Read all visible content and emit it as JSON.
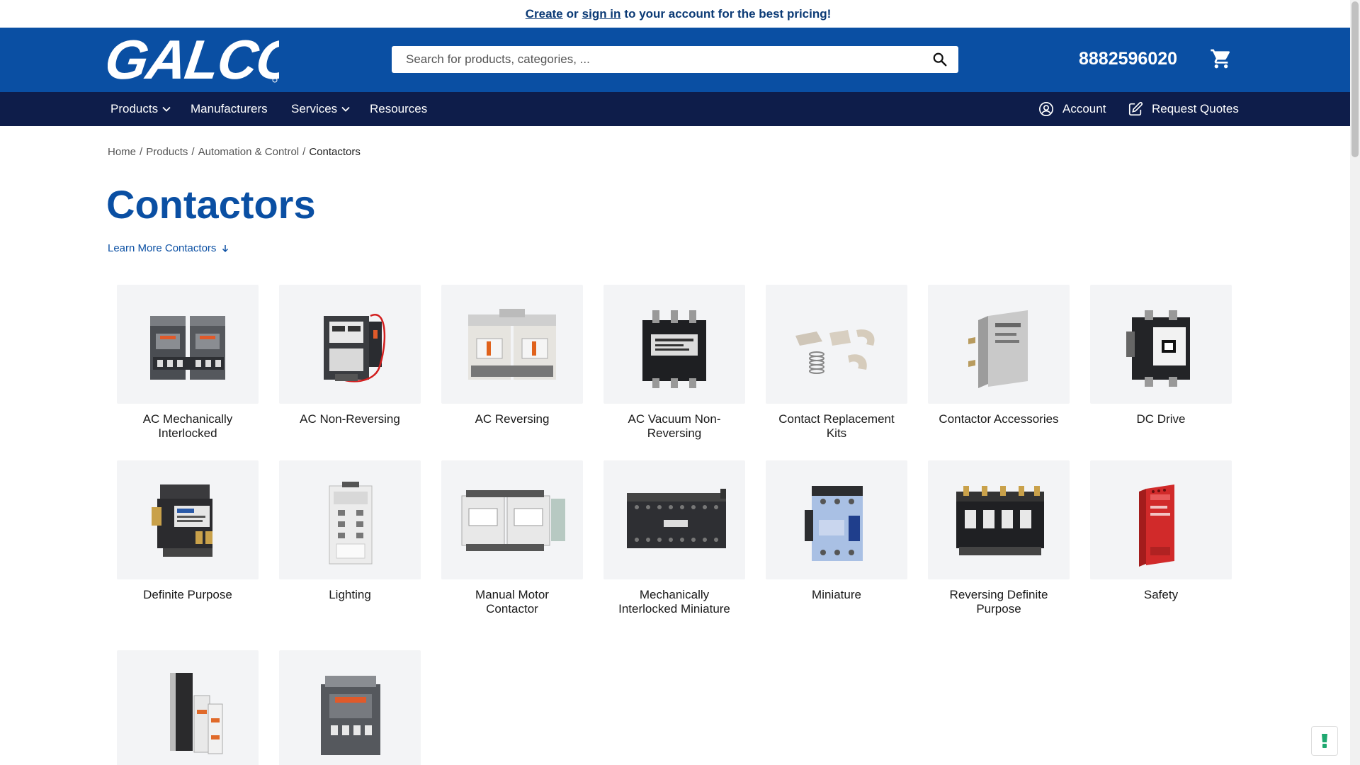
{
  "promo": {
    "create": "Create",
    "or": "or",
    "sign_in": "sign in",
    "rest": "to your account for the best pricing!"
  },
  "header": {
    "logo": "GALCO",
    "search_placeholder": "Search for products, categories, ...",
    "phone": "8882596020"
  },
  "nav": {
    "products": "Products",
    "manufacturers": "Manufacturers",
    "services": "Services",
    "resources": "Resources",
    "account": "Account",
    "request_quotes": "Request Quotes"
  },
  "breadcrumb": {
    "home": "Home",
    "products": "Products",
    "automation": "Automation & Control",
    "current": "Contactors",
    "sep": "/"
  },
  "page": {
    "title": "Contactors",
    "learn_more": "Learn More Contactors"
  },
  "categories": [
    {
      "label": "AC Mechanically Interlocked"
    },
    {
      "label": "AC Non-Reversing"
    },
    {
      "label": "AC Reversing"
    },
    {
      "label": "AC Vacuum Non-Reversing"
    },
    {
      "label": "Contact Replacement Kits"
    },
    {
      "label": "Contactor Accessories"
    },
    {
      "label": "DC Drive"
    },
    {
      "label": "Definite Purpose"
    },
    {
      "label": "Lighting"
    },
    {
      "label": "Manual Motor Contactor"
    },
    {
      "label": "Mechanically Interlocked Miniature"
    },
    {
      "label": "Miniature"
    },
    {
      "label": "Reversing Definite Purpose"
    },
    {
      "label": "Safety"
    },
    {
      "label": ""
    },
    {
      "label": ""
    }
  ],
  "colors": {
    "brand_blue": "#0a4fa3",
    "nav_dark": "#0e1d4a",
    "safety_red": "#c8102e",
    "feedback_green": "#1fa870"
  }
}
